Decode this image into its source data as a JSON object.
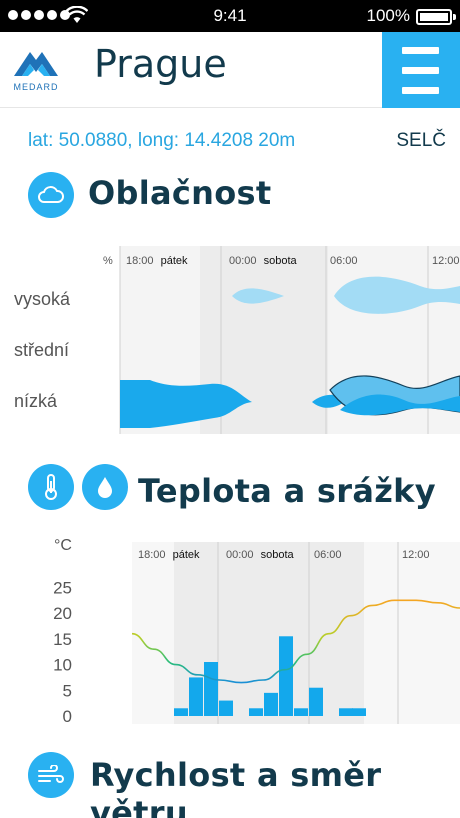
{
  "status_bar": {
    "time": "9:41",
    "battery": "100%",
    "signal_dots": 5
  },
  "header": {
    "logo_text": "MEDARD",
    "city": "Prague",
    "menu_icon": "hamburger-icon"
  },
  "location": {
    "coords": "lat: 50.0880, long: 14.4208 20m",
    "timezone": "SELČ"
  },
  "cloudiness": {
    "title": "Oblačnost",
    "icon": "cloud-icon",
    "unit": "%",
    "levels": [
      "vysoká",
      "střední",
      "nízká"
    ],
    "time_labels": [
      {
        "time": "18:00",
        "day": "pátek"
      },
      {
        "time": "00:00",
        "day": "sobota"
      },
      {
        "time": "06:00",
        "day": ""
      },
      {
        "time": "12:00",
        "day": ""
      }
    ]
  },
  "temperature": {
    "title": "Teplota a srážky",
    "icons": [
      "thermometer-icon",
      "drop-icon"
    ],
    "unit": "°C",
    "y_ticks": [
      "25",
      "20",
      "15",
      "10",
      "5",
      "0"
    ],
    "time_labels": [
      {
        "time": "18:00",
        "day": "pátek"
      },
      {
        "time": "00:00",
        "day": "sobota"
      },
      {
        "time": "06:00",
        "day": ""
      },
      {
        "time": "12:00",
        "day": ""
      }
    ]
  },
  "chart_data": [
    {
      "type": "area",
      "title": "Oblačnost",
      "ylabel": "%",
      "levels": [
        "vysoká",
        "střední",
        "nízká"
      ],
      "x_labels": [
        "18:00 pátek",
        "00:00 sobota",
        "06:00",
        "12:00"
      ]
    },
    {
      "type": "line",
      "title": "Teplota a srážky",
      "ylabel": "°C",
      "ylim": [
        0,
        28
      ],
      "x_labels": [
        "18:00 pátek",
        "00:00 sobota",
        "06:00",
        "12:00"
      ],
      "series": [
        {
          "values": [
            16,
            13,
            10,
            8,
            7,
            6.5,
            7,
            9,
            12,
            16,
            19.5,
            21.5,
            22.5,
            22.5,
            22,
            21
          ]
        }
      ],
      "bars": [
        1.5,
        7.5,
        10.5,
        3,
        0,
        1.5,
        4.5,
        15.5,
        1.5,
        5.5,
        0,
        1.5
      ]
    }
  ],
  "wind": {
    "title": "Rychlost a směr větru",
    "icon": "wind-icon"
  }
}
